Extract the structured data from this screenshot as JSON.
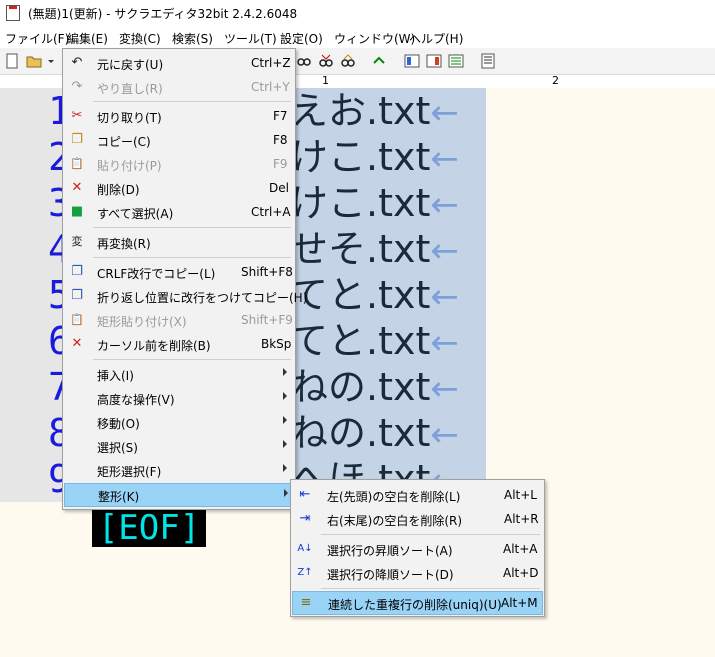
{
  "window": {
    "title": "(無題)1(更新) - サクラエディタ32bit 2.4.2.6048"
  },
  "menubar": [
    {
      "label": "ファイル(F)"
    },
    {
      "label": "編集(E)"
    },
    {
      "label": "変換(C)"
    },
    {
      "label": "検索(S)"
    },
    {
      "label": "ツール(T)"
    },
    {
      "label": "設定(O)"
    },
    {
      "label": "ウィンドウ(W)"
    },
    {
      "label": "ヘルプ(H)"
    }
  ],
  "ruler": {
    "marks": [
      "1",
      "2"
    ]
  },
  "editor": {
    "line_numbers": [
      "1",
      "2",
      "3",
      "4",
      "5",
      "6",
      "7",
      "8",
      "9"
    ],
    "lines": [
      "えお.txt",
      "けこ.txt",
      "けこ.txt",
      "せそ.txt",
      "てと.txt",
      "てと.txt",
      "ねの.txt",
      "ねの.txt",
      "へほ.txt"
    ],
    "newline_glyph": "←",
    "eof_marker": "[EOF]"
  },
  "edit_menu": {
    "items": [
      {
        "label": "元に戻す(U)",
        "shortcut": "Ctrl+Z",
        "icon": "undo-icon",
        "glyph": "↶",
        "disabled": false
      },
      {
        "label": "やり直し(R)",
        "shortcut": "Ctrl+Y",
        "icon": "redo-icon",
        "glyph": "↷",
        "disabled": true
      },
      {
        "label": "切り取り(T)",
        "shortcut": "F7",
        "icon": "cut-icon",
        "glyph": "✂",
        "disabled": false
      },
      {
        "label": "コピー(C)",
        "shortcut": "F8",
        "icon": "copy-icon",
        "glyph": "❐",
        "disabled": false
      },
      {
        "label": "貼り付け(P)",
        "shortcut": "F9",
        "icon": "paste-icon",
        "glyph": "📋",
        "disabled": true
      },
      {
        "label": "削除(D)",
        "shortcut": "Del",
        "icon": "delete-icon",
        "glyph": "✕",
        "disabled": false
      },
      {
        "label": "すべて選択(A)",
        "shortcut": "Ctrl+A",
        "icon": "select-all-icon",
        "glyph": "■",
        "disabled": false
      },
      {
        "label": "再変換(R)",
        "shortcut": "",
        "icon": "reconvert-icon",
        "glyph": "変",
        "disabled": false
      },
      {
        "label": "CRLF改行でコピー(L)",
        "shortcut": "Shift+F8",
        "icon": "copy-crlf-icon",
        "glyph": "❐",
        "disabled": false
      },
      {
        "label": "折り返し位置に改行をつけてコピー(H)",
        "shortcut": "",
        "icon": "copy-wrap-icon",
        "glyph": "❐",
        "disabled": false
      },
      {
        "label": "矩形貼り付け(X)",
        "shortcut": "Shift+F9",
        "icon": "box-paste-icon",
        "glyph": "📋",
        "disabled": true
      },
      {
        "label": "カーソル前を削除(B)",
        "shortcut": "BkSp",
        "icon": "backspace-icon",
        "glyph": "✕",
        "disabled": false
      },
      {
        "label": "挿入(I)",
        "shortcut": "",
        "icon": "",
        "glyph": "",
        "disabled": false,
        "submenu": true
      },
      {
        "label": "高度な操作(V)",
        "shortcut": "",
        "icon": "",
        "glyph": "",
        "disabled": false,
        "submenu": true
      },
      {
        "label": "移動(O)",
        "shortcut": "",
        "icon": "",
        "glyph": "",
        "disabled": false,
        "submenu": true
      },
      {
        "label": "選択(S)",
        "shortcut": "",
        "icon": "",
        "glyph": "",
        "disabled": false,
        "submenu": true
      },
      {
        "label": "矩形選択(F)",
        "shortcut": "",
        "icon": "",
        "glyph": "",
        "disabled": false,
        "submenu": true
      },
      {
        "label": "整形(K)",
        "shortcut": "",
        "icon": "",
        "glyph": "",
        "disabled": false,
        "submenu": true,
        "highlighted": true
      }
    ]
  },
  "format_submenu": {
    "items": [
      {
        "label": "左(先頭)の空白を削除(L)",
        "shortcut": "Alt+L",
        "icon": "trim-left-icon",
        "glyph": "⇤",
        "highlighted": false
      },
      {
        "label": "右(末尾)の空白を削除(R)",
        "shortcut": "Alt+R",
        "icon": "trim-right-icon",
        "glyph": "⇥",
        "highlighted": false
      },
      {
        "label": "選択行の昇順ソート(A)",
        "shortcut": "Alt+A",
        "icon": "sort-asc-icon",
        "glyph": "A↓",
        "highlighted": false
      },
      {
        "label": "選択行の降順ソート(D)",
        "shortcut": "Alt+D",
        "icon": "sort-desc-icon",
        "glyph": "Z↑",
        "highlighted": false
      },
      {
        "label": "連続した重複行の削除(uniq)(U)",
        "shortcut": "Alt+M",
        "icon": "uniq-icon",
        "glyph": "≡",
        "highlighted": true
      }
    ]
  },
  "colors": {
    "line_number": "#1a1adc",
    "selection": "#c5d3e6",
    "eof_text": "#00e6e6",
    "highlight": "#99d3f6"
  }
}
